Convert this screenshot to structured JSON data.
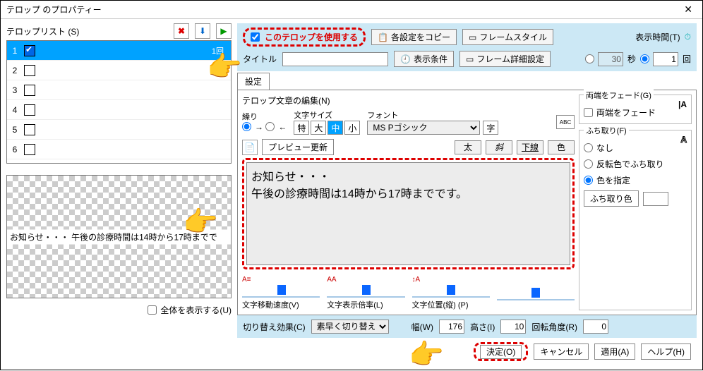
{
  "window": {
    "title": "テロップ のプロパティー"
  },
  "left": {
    "list_label": "テロップリスト (S)",
    "rows": [
      {
        "num": "1",
        "count": "1回"
      },
      {
        "num": "2"
      },
      {
        "num": "3"
      },
      {
        "num": "4"
      },
      {
        "num": "5"
      },
      {
        "num": "6"
      }
    ],
    "preview_text": "お知らせ・・・ 午後の診療時間は14時から17時までで",
    "show_all": "全体を表示する(U)"
  },
  "top": {
    "use_telop": "このテロップを使用する",
    "copy_settings": "各設定をコピー",
    "frame_style": "フレームスタイル",
    "title_label": "タイトル",
    "display_cond": "表示条件",
    "frame_detail": "フレーム詳細設定",
    "disp_time_label": "表示時間(T)",
    "time_val": "30",
    "sec": "秒",
    "count_val": "1",
    "count_unit": "回"
  },
  "tabs": {
    "settings": "設定"
  },
  "edit": {
    "header": "テロップ文章の編集(N)",
    "scroll_label": "繰り",
    "font_size_label": "文字サイズ",
    "font_label": "フォント",
    "sizes": {
      "xl": "特",
      "l": "大",
      "m": "中",
      "s": "小"
    },
    "font_value": "MS Pゴシック",
    "font_btn": "字",
    "preview_update": "プレビュー更新",
    "bold": "太",
    "italic": "斜",
    "underline": "下線",
    "color": "色",
    "text": "お知らせ・・・\n午後の診療時間は14時から17時までです。",
    "speed_icon": "A≡",
    "speed": "文字移動速度(V)",
    "mag_icon": "AA",
    "magnify": "文字表示倍率(L)",
    "pos_icon": "↕A",
    "pos": "文字位置(縦) (P)"
  },
  "fade": {
    "group": "両端をフェード(G)",
    "check": "両端をフェード"
  },
  "outline": {
    "group": "ふち取り(F)",
    "none": "なし",
    "invert": "反転色でふち取り",
    "specify": "色を指定",
    "color_btn": "ふち取り色"
  },
  "bottom": {
    "transition": "切り替え効果(C)",
    "transition_val": "素早く切り替え",
    "width_label": "幅(W)",
    "width_val": "176",
    "height_label": "高さ(I)",
    "height_val": "10",
    "angle_label": "回転角度(R)",
    "angle_val": "0",
    "ok": "決定(O)",
    "cancel": "キャンセル",
    "apply": "適用(A)",
    "help": "ヘルプ(H)"
  }
}
